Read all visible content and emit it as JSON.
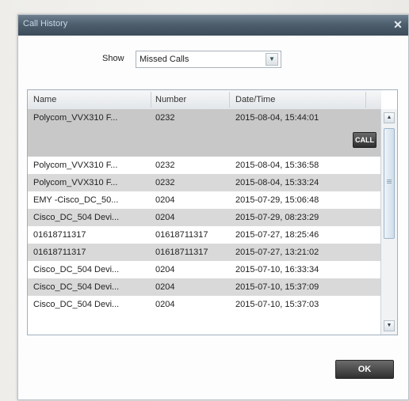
{
  "dialog": {
    "title": "Call History",
    "close_icon": "close-icon"
  },
  "filter": {
    "show_label": "Show",
    "selected": "Missed Calls",
    "dropdown_icon": "chevron-down-icon"
  },
  "table": {
    "columns": [
      "Name",
      "Number",
      "Date/Time"
    ],
    "rows": [
      {
        "name": "Polycom_VVX310 F...",
        "number": "0232",
        "datetime": "2015-08-04, 15:44:01"
      },
      {
        "name": "Polycom_VVX310 F...",
        "number": "0232",
        "datetime": "2015-08-04, 15:36:58"
      },
      {
        "name": "Polycom_VVX310 F...",
        "number": "0232",
        "datetime": "2015-08-04, 15:33:24"
      },
      {
        "name": "EMY -Cisco_DC_50...",
        "number": "0204",
        "datetime": "2015-07-29, 15:06:48"
      },
      {
        "name": "Cisco_DC_504 Devi...",
        "number": "0204",
        "datetime": "2015-07-29, 08:23:29"
      },
      {
        "name": "01618711317",
        "number": "01618711317",
        "datetime": "2015-07-27, 18:25:46"
      },
      {
        "name": "01618711317",
        "number": "01618711317",
        "datetime": "2015-07-27, 13:21:02"
      },
      {
        "name": "Cisco_DC_504 Devi...",
        "number": "0204",
        "datetime": "2015-07-10, 16:33:34"
      },
      {
        "name": "Cisco_DC_504 Devi...",
        "number": "0204",
        "datetime": "2015-07-10, 15:37:09"
      },
      {
        "name": "Cisco_DC_504 Devi...",
        "number": "0204",
        "datetime": "2015-07-10, 15:37:03"
      }
    ],
    "call_button_label": "CALL"
  },
  "footer": {
    "ok_label": "OK"
  }
}
